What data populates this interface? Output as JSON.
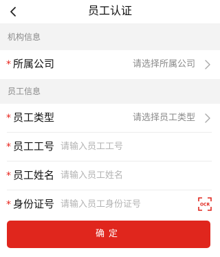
{
  "header": {
    "title": "员工认证",
    "back_icon": "chevron-left-icon"
  },
  "sections": {
    "org_info": "机构信息",
    "employee_info": "员工信息"
  },
  "fields": {
    "company": {
      "required": "*",
      "label": "所属公司",
      "value": "请选择所属公司",
      "icon": "chevron-right-icon"
    },
    "employee_type": {
      "required": "*",
      "label": "员工类型",
      "value": "请选择员工类型",
      "icon": "chevron-right-icon"
    },
    "employee_id": {
      "required": "*",
      "label": "员工工号",
      "placeholder": "请输入员工工号"
    },
    "employee_name": {
      "required": "*",
      "label": "员工姓名",
      "placeholder": "请输入员工姓名"
    },
    "id_number": {
      "required": "*",
      "label": "身份证号",
      "placeholder": "请输入员工身份证号",
      "icon": "ocr-scan-icon",
      "icon_text": "OCR"
    }
  },
  "footer": {
    "confirm_label": "确定"
  },
  "colors": {
    "accent": "#e0261d",
    "required": "#e8231b",
    "background": "#f3f3f3"
  }
}
